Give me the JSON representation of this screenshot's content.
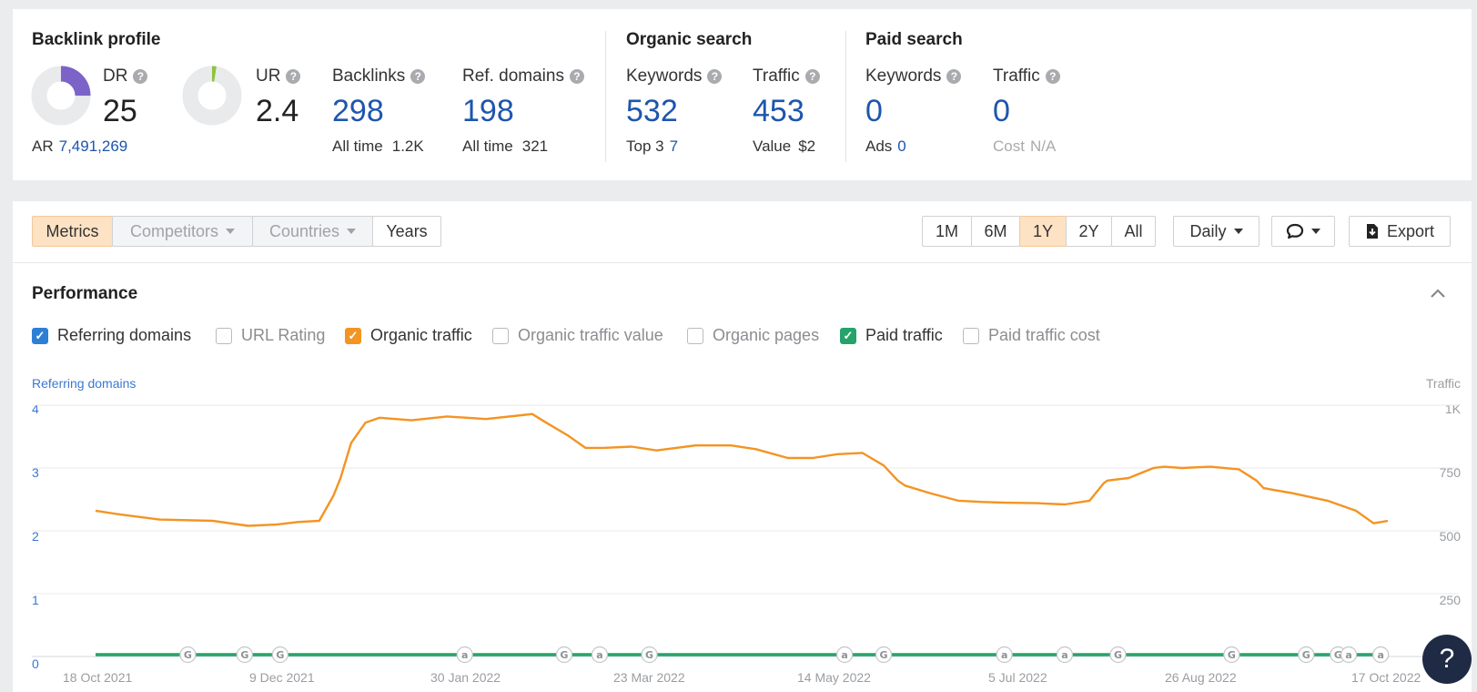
{
  "backlink": {
    "title": "Backlink profile",
    "dr_label": "DR",
    "dr_value": "25",
    "dr_fraction": 0.25,
    "ar_label": "AR",
    "ar_value": "7,491,269",
    "ur_label": "UR",
    "ur_value": "2.4",
    "ur_fraction": 0.024,
    "backlinks_label": "Backlinks",
    "backlinks_value": "298",
    "backlinks_sub_label": "All time",
    "backlinks_sub_value": "1.2K",
    "refdomains_label": "Ref. domains",
    "refdomains_value": "198",
    "refdomains_sub_label": "All time",
    "refdomains_sub_value": "321",
    "colors": {
      "dr": "#7b63c7",
      "ur": "#8dc43f",
      "track": "#e9eaec"
    }
  },
  "organic": {
    "title": "Organic search",
    "keywords_label": "Keywords",
    "keywords_value": "532",
    "keywords_sub_label": "Top 3",
    "keywords_sub_value": "7",
    "traffic_label": "Traffic",
    "traffic_value": "453",
    "traffic_sub_label": "Value",
    "traffic_sub_value": "$2"
  },
  "paid": {
    "title": "Paid search",
    "keywords_label": "Keywords",
    "keywords_value": "0",
    "keywords_sub_label": "Ads",
    "keywords_sub_value": "0",
    "traffic_label": "Traffic",
    "traffic_value": "0",
    "traffic_sub_label": "Cost",
    "traffic_sub_value": "N/A"
  },
  "help_icon": "?",
  "toolbar": {
    "tabs": [
      "Metrics",
      "Competitors",
      "Countries",
      "Years"
    ],
    "active_tab": "Metrics",
    "ranges": [
      "1M",
      "6M",
      "1Y",
      "2Y",
      "All"
    ],
    "active_range": "1Y",
    "interval": "Daily",
    "export": "Export",
    "icons": {
      "comment": "comment-icon",
      "export": "download-icon"
    }
  },
  "performance": {
    "title": "Performance",
    "metrics": [
      {
        "label": "Referring domains",
        "checked": true,
        "color": "#2d7fd6"
      },
      {
        "label": "URL Rating",
        "checked": false,
        "color": ""
      },
      {
        "label": "Organic traffic",
        "checked": true,
        "color": "#f39423"
      },
      {
        "label": "Organic traffic value",
        "checked": false,
        "color": ""
      },
      {
        "label": "Organic pages",
        "checked": false,
        "color": ""
      },
      {
        "label": "Paid traffic",
        "checked": true,
        "color": "#25a36a"
      },
      {
        "label": "Paid traffic cost",
        "checked": false,
        "color": ""
      }
    ]
  },
  "chart_data": {
    "type": "line",
    "ylabel_left": "Referring domains",
    "ylabel_right": "Traffic",
    "ylim_left": [
      0,
      4
    ],
    "ylim_right": [
      0,
      1000
    ],
    "yticks_left": [
      "0",
      "1",
      "2",
      "3",
      "4"
    ],
    "yticks_right": [
      "250",
      "500",
      "750",
      "1K"
    ],
    "xticks": [
      "18 Oct 2021",
      "9 Dec 2021",
      "30 Jan 2022",
      "23 Mar 2022",
      "14 May 2022",
      "5 Jul 2022",
      "26 Aug 2022",
      "17 Oct 2022"
    ],
    "grid": true,
    "series": [
      {
        "name": "Organic traffic",
        "axis": "right",
        "color": "#f39423",
        "x": [
          "2021-10-18",
          "2021-10-25",
          "2021-11-05",
          "2021-11-20",
          "2021-11-30",
          "2021-12-08",
          "2021-12-14",
          "2021-12-20",
          "2021-12-24",
          "2021-12-26",
          "2021-12-29",
          "2022-01-02",
          "2022-01-06",
          "2022-01-15",
          "2022-01-25",
          "2022-02-05",
          "2022-02-15",
          "2022-02-18",
          "2022-02-22",
          "2022-02-28",
          "2022-03-05",
          "2022-03-10",
          "2022-03-18",
          "2022-03-25",
          "2022-04-05",
          "2022-04-15",
          "2022-04-22",
          "2022-05-01",
          "2022-05-08",
          "2022-05-15",
          "2022-05-22",
          "2022-05-28",
          "2022-06-01",
          "2022-06-03",
          "2022-06-10",
          "2022-06-18",
          "2022-06-25",
          "2022-07-01",
          "2022-07-10",
          "2022-07-18",
          "2022-07-25",
          "2022-07-29",
          "2022-07-30",
          "2022-08-05",
          "2022-08-12",
          "2022-08-15",
          "2022-08-20",
          "2022-08-28",
          "2022-09-05",
          "2022-09-10",
          "2022-09-12",
          "2022-09-20",
          "2022-09-30",
          "2022-10-08",
          "2022-10-13",
          "2022-10-17"
        ],
        "y": [
          580,
          565,
          545,
          540,
          520,
          525,
          535,
          540,
          640,
          710,
          850,
          930,
          950,
          940,
          955,
          945,
          960,
          965,
          930,
          880,
          830,
          830,
          835,
          820,
          840,
          840,
          825,
          790,
          790,
          805,
          810,
          760,
          700,
          680,
          650,
          620,
          615,
          612,
          610,
          605,
          620,
          690,
          700,
          710,
          750,
          755,
          750,
          755,
          745,
          700,
          670,
          650,
          620,
          580,
          530,
          540
        ]
      },
      {
        "name": "Paid traffic",
        "axis": "right",
        "color": "#25a36a",
        "x": [
          "2021-10-18",
          "2022-10-17"
        ],
        "y": [
          0,
          0
        ]
      }
    ],
    "annotations": {
      "x": [
        "2021-11-13",
        "2021-11-29",
        "2021-12-09",
        "2022-01-30",
        "2022-02-27",
        "2022-03-09",
        "2022-03-23",
        "2022-05-17",
        "2022-05-28",
        "2022-07-01",
        "2022-07-18",
        "2022-08-02",
        "2022-09-03",
        "2022-09-24",
        "2022-10-03",
        "2022-10-06",
        "2022-10-15"
      ],
      "labels": [
        "G",
        "G",
        "G",
        "a",
        "G",
        "a",
        "G",
        "a",
        "G",
        "a",
        "a",
        "G",
        "G",
        "G",
        "G",
        "a",
        "a"
      ]
    }
  }
}
